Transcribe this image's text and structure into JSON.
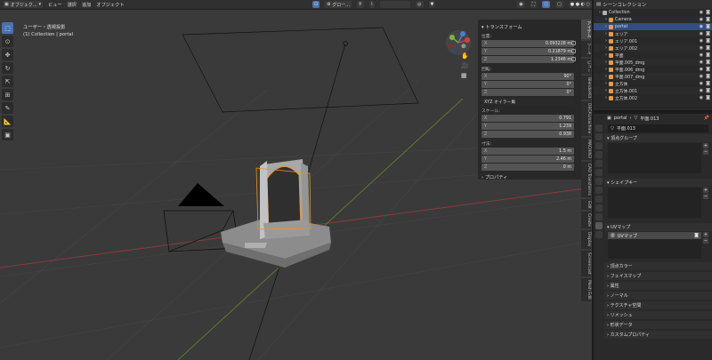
{
  "header": {
    "mode_label": "オブジェク...",
    "menus": [
      "ビュー",
      "選択",
      "追加",
      "オブジェクト"
    ],
    "transform_orient": "グロー...",
    "options_label": "オプション"
  },
  "viewport": {
    "view_title": "ユーザー・透視投影",
    "collection_info": "(1) Collection | portal"
  },
  "npanel": {
    "transform_title": "トランスフォーム",
    "location_label": "位置:",
    "location": {
      "x": "0.093228 m",
      "y": "0.21879 m",
      "z": "1.2346 m"
    },
    "rotation_label": "回転:",
    "rotation": {
      "x": "90°",
      "y": "0°",
      "z": "0°"
    },
    "rotation_mode": "XYZ オイラー角",
    "scale_label": "スケール:",
    "scale": {
      "x": "0.791",
      "y": "1.239",
      "z": "0.938"
    },
    "dims_label": "寸法:",
    "dims": {
      "x": "1.5 m",
      "y": "2.46 m",
      "z": "0 m"
    },
    "props_label": "プロパティ",
    "axis_x": "X",
    "axis_y": "Y",
    "axis_z": "Z"
  },
  "vtabs": [
    "アイテム",
    "ツール",
    "ビュー",
    "BlenderKit",
    "DECALmachine",
    "MACHIN3",
    "CAD Transforms",
    "Edit",
    "Create",
    "Display",
    "Screencast",
    "Mesh Edit"
  ],
  "outliner": {
    "title": "シーンコレクション",
    "rows": [
      {
        "label": "Collection",
        "indent": 0,
        "color": "#b0b0b0",
        "sel": false
      },
      {
        "label": "Camera",
        "indent": 1,
        "color": "#e59b4a",
        "sel": false
      },
      {
        "label": "portal",
        "indent": 1,
        "color": "#e59b4a",
        "sel": true
      },
      {
        "label": "エリア",
        "indent": 1,
        "color": "#e59b4a",
        "sel": false
      },
      {
        "label": "エリア.001",
        "indent": 1,
        "color": "#e59b4a",
        "sel": false
      },
      {
        "label": "エリア.002",
        "indent": 1,
        "color": "#e59b4a",
        "sel": false
      },
      {
        "label": "平面",
        "indent": 1,
        "color": "#e59b4a",
        "sel": false
      },
      {
        "label": "平面.005_dmg",
        "indent": 1,
        "color": "#e59b4a",
        "sel": false
      },
      {
        "label": "平面.006_dmg",
        "indent": 1,
        "color": "#e59b4a",
        "sel": false
      },
      {
        "label": "平面.007_dmg",
        "indent": 1,
        "color": "#e59b4a",
        "sel": false
      },
      {
        "label": "立方体",
        "indent": 1,
        "color": "#e59b4a",
        "sel": false
      },
      {
        "label": "立方体.001",
        "indent": 1,
        "color": "#e59b4a",
        "sel": false
      },
      {
        "label": "立方体.002",
        "indent": 1,
        "color": "#e59b4a",
        "sel": false
      }
    ]
  },
  "properties": {
    "breadcrumb_obj": "portal",
    "breadcrumb_mesh": "平面.013",
    "mesh_name": "平面.013",
    "sections": {
      "vertex_groups": "頂点グループ",
      "shape_keys": "シェイプキー",
      "uv_maps": "UVマップ",
      "uv_item": "UVマップ",
      "vertex_colors": "頂点カラー",
      "face_maps": "フェイスマップ",
      "attributes": "属性",
      "normals": "ノーマル",
      "texture_space": "テクスチャ空間",
      "remesh": "リメッシュ",
      "geometry_data": "形状データ",
      "custom_props": "カスタムプロパティ"
    }
  },
  "colors": {
    "accent": "#4a72b0",
    "selection": "#e59b4a",
    "axis_x": "#d4403a",
    "axis_y": "#7ab83a",
    "axis_z": "#4a7ed4"
  }
}
